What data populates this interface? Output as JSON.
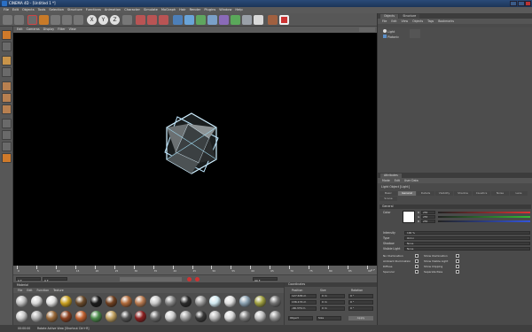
{
  "window": {
    "title": "CINEMA 4D - [Untitled 1 *]"
  },
  "menu": [
    "File",
    "Edit",
    "Objects",
    "Tools",
    "Selection",
    "Structure",
    "Functions",
    "Animation",
    "Character",
    "Simulate",
    "MoGraph",
    "Hair",
    "Render",
    "Plugins",
    "Window",
    "Help"
  ],
  "toolbar": {
    "axis_labels": [
      "X",
      "Y",
      "Z"
    ]
  },
  "viewport_menu": [
    "Edit",
    "Cameras",
    "Display",
    "Filter",
    "View"
  ],
  "timeline": {
    "ticks": [
      "0",
      "5",
      "10",
      "15",
      "20",
      "25",
      "30",
      "35",
      "40",
      "45",
      "50",
      "55",
      "60",
      "65",
      "70",
      "75",
      "80",
      "85",
      "90"
    ],
    "end": "0 F",
    "frame_field": "0 F",
    "start_field": "0 F",
    "end_field": "90 F"
  },
  "material_panel": {
    "title": "Material",
    "menu": [
      "File",
      "Edit",
      "Function",
      "Texture"
    ]
  },
  "coordinates_panel": {
    "title": "Coordinates",
    "headers": [
      "Position",
      "Size",
      "Rotation"
    ],
    "rows": [
      {
        "pos": "127.636 m",
        "size": "0 m",
        "rot": "0 °"
      },
      {
        "pos": "136.174 m",
        "size": "0 m",
        "rot": "0 °"
      },
      {
        "pos": "-96.379 m",
        "size": "0 m",
        "rot": "0 °"
      }
    ],
    "object_mode": "Object",
    "size_mode": "Size",
    "apply": "Apply"
  },
  "status_bar": {
    "time": "00:00:00",
    "message": "Rotate Active View [Shortcut Ctrl+R]"
  },
  "objects_panel": {
    "tabs": [
      "Objects",
      "Structure"
    ],
    "menu": [
      "File",
      "Edit",
      "View",
      "Objects",
      "Tags",
      "Bookmarks"
    ],
    "items": [
      "Light",
      "Platonic"
    ]
  },
  "attributes_panel": {
    "tab_title": "Attributes",
    "menu": [
      "Mode",
      "Edit",
      "User Data"
    ],
    "object_label": "Light Object [Light]",
    "tabs": [
      "Basic",
      "General",
      "Details",
      "Visibility",
      "Shadow",
      "Caustics",
      "Noise",
      "Lens",
      "Scene"
    ],
    "section": "General",
    "color_label": "Color",
    "rgb": [
      {
        "label": "R",
        "value": "255"
      },
      {
        "label": "G",
        "value": "255"
      },
      {
        "label": "B",
        "value": "255"
      }
    ],
    "properties": [
      {
        "label": "Intensity",
        "value": "100 %"
      },
      {
        "label": "Type",
        "value": "Omni"
      },
      {
        "label": "Shadow",
        "value": "None"
      },
      {
        "label": "Visible Light",
        "value": "None"
      }
    ],
    "checks_left": [
      "No Illumination",
      "Ambient Illumination",
      "Diffuse",
      "Specular"
    ],
    "checks_right": [
      "Show Illumination",
      "Show Visible Light",
      "Show Clipping",
      "Separate Pass"
    ]
  },
  "colors": {
    "accent_orange": "#e08a1e",
    "viewport_bg": "#000000",
    "selection_blue": "#3b5f8a"
  }
}
